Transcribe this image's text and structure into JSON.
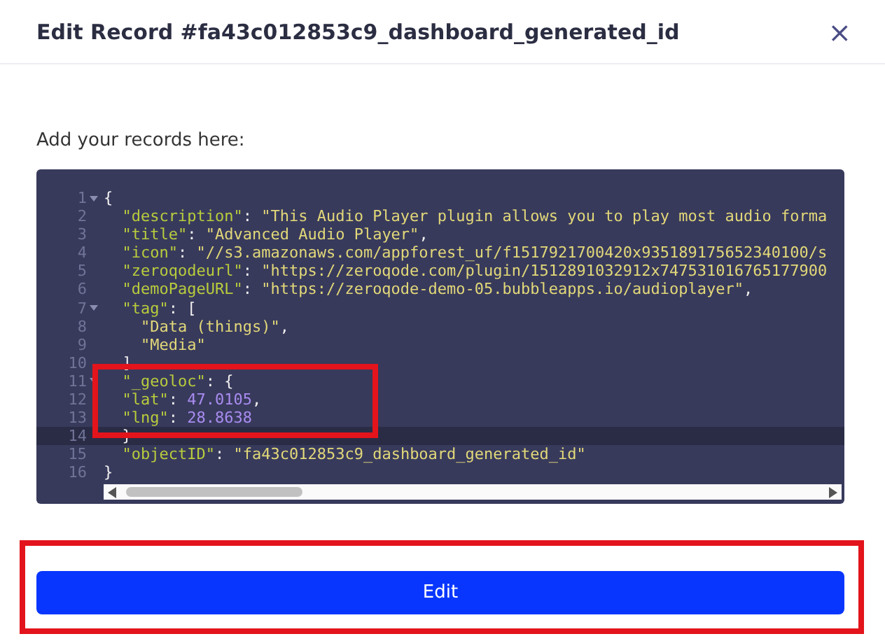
{
  "dialog": {
    "title": "Edit Record #fa43c012853c9_dashboard_generated_id",
    "close": "×"
  },
  "prompt": "Add your records here:",
  "editor": {
    "lines": [
      {
        "number": "1",
        "fold": true,
        "active": false,
        "tokens": [
          {
            "kind": "punct",
            "text": "{"
          }
        ]
      },
      {
        "number": "2",
        "fold": false,
        "active": false,
        "tokens": [
          {
            "kind": "key",
            "text": "  \"description\""
          },
          {
            "kind": "punct",
            "text": ": "
          },
          {
            "kind": "string",
            "text": "\"This Audio Player plugin allows you to play most audio forma"
          }
        ]
      },
      {
        "number": "3",
        "fold": false,
        "active": false,
        "tokens": [
          {
            "kind": "key",
            "text": "  \"title\""
          },
          {
            "kind": "punct",
            "text": ": "
          },
          {
            "kind": "string",
            "text": "\"Advanced Audio Player\""
          },
          {
            "kind": "punct",
            "text": ","
          }
        ]
      },
      {
        "number": "4",
        "fold": false,
        "active": false,
        "tokens": [
          {
            "kind": "key",
            "text": "  \"icon\""
          },
          {
            "kind": "punct",
            "text": ": "
          },
          {
            "kind": "string",
            "text": "\"//s3.amazonaws.com/appforest_uf/f1517921700420x935189175652340100/s"
          }
        ]
      },
      {
        "number": "5",
        "fold": false,
        "active": false,
        "tokens": [
          {
            "kind": "key",
            "text": "  \"zeroqodeurl\""
          },
          {
            "kind": "punct",
            "text": ": "
          },
          {
            "kind": "string",
            "text": "\"https://zeroqode.com/plugin/1512891032912x747531016765177900"
          }
        ]
      },
      {
        "number": "6",
        "fold": false,
        "active": false,
        "tokens": [
          {
            "kind": "key",
            "text": "  \"demoPageURL\""
          },
          {
            "kind": "punct",
            "text": ": "
          },
          {
            "kind": "string",
            "text": "\"https://zeroqode-demo-05.bubbleapps.io/audioplayer\""
          },
          {
            "kind": "punct",
            "text": ","
          }
        ]
      },
      {
        "number": "7",
        "fold": true,
        "active": false,
        "tokens": [
          {
            "kind": "key",
            "text": "  \"tag\""
          },
          {
            "kind": "punct",
            "text": ": ["
          }
        ]
      },
      {
        "number": "8",
        "fold": false,
        "active": false,
        "tokens": [
          {
            "kind": "string",
            "text": "    \"Data (things)\""
          },
          {
            "kind": "punct",
            "text": ","
          }
        ]
      },
      {
        "number": "9",
        "fold": false,
        "active": false,
        "tokens": [
          {
            "kind": "string",
            "text": "    \"Media\""
          }
        ]
      },
      {
        "number": "10",
        "fold": false,
        "active": false,
        "tokens": [
          {
            "kind": "punct",
            "text": "  ]"
          }
        ]
      },
      {
        "number": "11",
        "fold": true,
        "active": false,
        "tokens": [
          {
            "kind": "key",
            "text": "  \"_geoloc\""
          },
          {
            "kind": "punct",
            "text": ": {"
          }
        ]
      },
      {
        "number": "12",
        "fold": false,
        "active": false,
        "tokens": [
          {
            "kind": "key",
            "text": "  \"lat\""
          },
          {
            "kind": "punct",
            "text": ": "
          },
          {
            "kind": "number",
            "text": "47.0105"
          },
          {
            "kind": "punct",
            "text": ","
          }
        ]
      },
      {
        "number": "13",
        "fold": false,
        "active": false,
        "tokens": [
          {
            "kind": "key",
            "text": "  \"lng\""
          },
          {
            "kind": "punct",
            "text": ": "
          },
          {
            "kind": "number",
            "text": "28.8638"
          }
        ]
      },
      {
        "number": "14",
        "fold": false,
        "active": true,
        "tokens": [
          {
            "kind": "punct",
            "text": "  }"
          }
        ]
      },
      {
        "number": "15",
        "fold": false,
        "active": false,
        "tokens": [
          {
            "kind": "key",
            "text": "  \"objectID\""
          },
          {
            "kind": "punct",
            "text": ": "
          },
          {
            "kind": "string",
            "text": "\"fa43c012853c9_dashboard_generated_id\""
          }
        ]
      },
      {
        "number": "16",
        "fold": false,
        "active": false,
        "tokens": [
          {
            "kind": "punct",
            "text": "}"
          }
        ]
      }
    ]
  },
  "submit": "Edit"
}
